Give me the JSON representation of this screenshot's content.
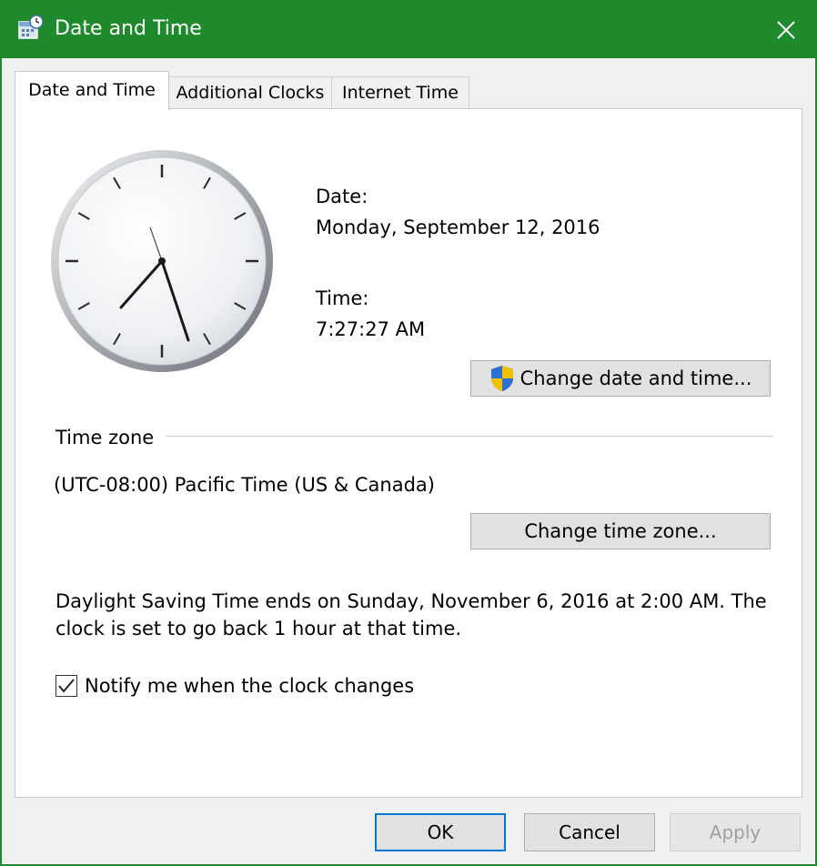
{
  "window": {
    "title": "Date and Time",
    "title_bar_color": "#1f8a2c",
    "icons": {
      "app": "calendar-clock-icon",
      "close": "close-icon"
    }
  },
  "tabs": [
    {
      "label": "Date and Time",
      "active": true
    },
    {
      "label": "Additional Clocks",
      "active": false
    },
    {
      "label": "Internet Time",
      "active": false
    }
  ],
  "datetime": {
    "date_label": "Date:",
    "date_value": "Monday, September 12, 2016",
    "time_label": "Time:",
    "time_value": "7:27:27 AM",
    "change_button": "Change date and time...",
    "change_button_icon": "uac-shield-icon"
  },
  "timezone": {
    "heading": "Time zone",
    "value": "(UTC-08:00) Pacific Time (US & Canada)",
    "change_button": "Change time zone..."
  },
  "dst": {
    "line1": "Daylight Saving Time ends on Sunday, November 6, 2016 at 2:00 AM. The",
    "line2": "clock is set to go back 1 hour at that time.",
    "notify_label": "Notify me when the clock changes",
    "notify_checked": true
  },
  "footer": {
    "ok": "OK",
    "cancel": "Cancel",
    "apply": "Apply",
    "apply_enabled": false,
    "accent": "#0078d7"
  }
}
